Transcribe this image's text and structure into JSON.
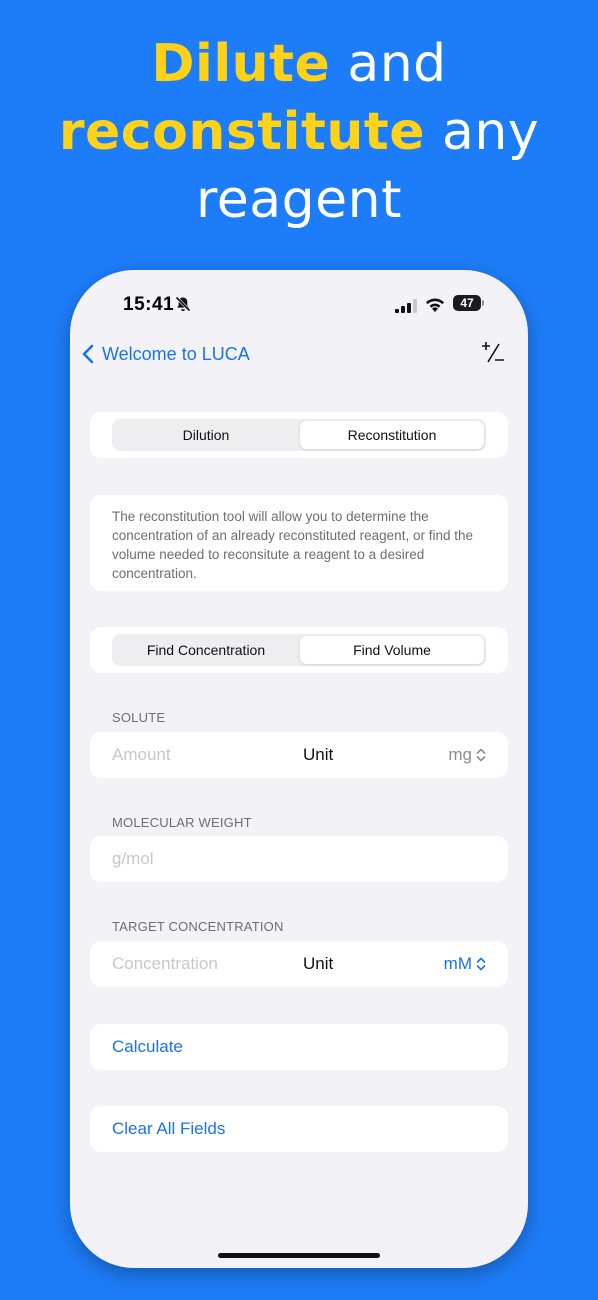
{
  "promo": {
    "line1_highlight": "Dilute",
    "line1_rest": " and",
    "line2_highlight": "reconstitute",
    "line2_rest": " any",
    "line3": "reagent"
  },
  "status_bar": {
    "time": "15:41",
    "battery": "47"
  },
  "nav": {
    "back_label": "Welcome to LUCA",
    "action_label": "+/−"
  },
  "mode_tabs": [
    {
      "label": "Dilution",
      "selected": false
    },
    {
      "label": "Reconstitution",
      "selected": true
    }
  ],
  "description": "The reconstitution tool will allow you to determine the concentration of an already reconstituted reagent, or find the volume needed to reconsitute a reagent to a desired concentration.",
  "find_tabs": [
    {
      "label": "Find Concentration",
      "selected": false
    },
    {
      "label": "Find Volume",
      "selected": true
    }
  ],
  "solute": {
    "section_label": "SOLUTE",
    "amount_placeholder": "Amount",
    "amount_value": "",
    "unit_label": "Unit",
    "unit_value": "mg"
  },
  "molecular_weight": {
    "section_label": "MOLECULAR WEIGHT",
    "placeholder": "g/mol",
    "value": ""
  },
  "target_concentration": {
    "section_label": "TARGET CONCENTRATION",
    "placeholder": "Concentration",
    "value": "",
    "unit_label": "Unit",
    "unit_value": "mM"
  },
  "actions": {
    "calculate_label": "Calculate",
    "clear_label": "Clear All Fields"
  },
  "colors": {
    "background": "#1d7cf7",
    "highlight": "#ffd21a",
    "accent": "#1a73e8",
    "screen": "#f2f2f7"
  }
}
